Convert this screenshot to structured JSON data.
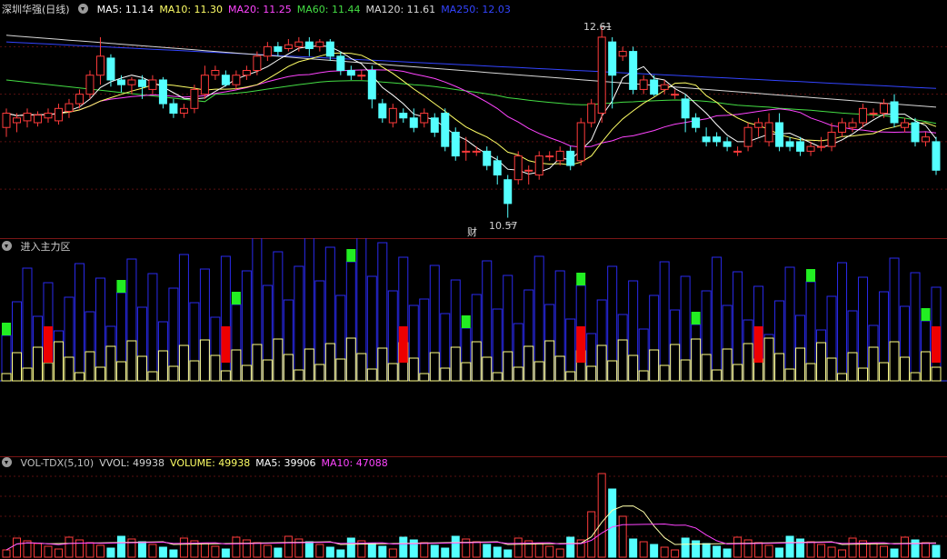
{
  "main_panel": {
    "title": "深圳华强(日线)",
    "ma": [
      {
        "label": "MA5: 11.14",
        "color": "#ffffff"
      },
      {
        "label": "MA10: 11.30",
        "color": "#ffff66"
      },
      {
        "label": "MA20: 11.25",
        "color": "#ff44ff"
      },
      {
        "label": "MA60: 11.44",
        "color": "#44dd44"
      },
      {
        "label": "MA120: 11.61",
        "color": "#d8d8d8"
      },
      {
        "label": "MA250: 12.03",
        "color": "#3344ff"
      }
    ],
    "high_label": "12.61",
    "low_label": "10.57",
    "marker_text": "财"
  },
  "indicator_panel": {
    "title": "进入主力区"
  },
  "volume_panel": {
    "items": [
      {
        "label": "VOL-TDX(5,10)",
        "color": "#c0c0c0"
      },
      {
        "label": "VVOL: 49938",
        "color": "#d0d0d0"
      },
      {
        "label": "VOLUME: 49938",
        "color": "#ffff66"
      },
      {
        "label": "MA5: 39906",
        "color": "#ffffff"
      },
      {
        "label": "MA10: 47088",
        "color": "#ff44ff"
      }
    ]
  },
  "chart_data": {
    "type": "candlestick",
    "candles": [
      [
        11.55,
        11.7,
        11.75,
        11.45
      ],
      [
        11.6,
        11.65,
        11.7,
        11.5
      ],
      [
        11.62,
        11.7,
        11.75,
        11.55
      ],
      [
        11.6,
        11.68,
        11.72,
        11.56
      ],
      [
        11.65,
        11.7,
        11.75,
        11.6
      ],
      [
        11.62,
        11.75,
        11.8,
        11.58
      ],
      [
        11.72,
        11.8,
        11.85,
        11.65
      ],
      [
        11.8,
        11.9,
        11.95,
        11.75
      ],
      [
        11.9,
        12.1,
        12.15,
        11.85
      ],
      [
        12.1,
        12.3,
        12.5,
        12.0
      ],
      [
        12.28,
        12.05,
        12.32,
        11.98
      ],
      [
        12.05,
        12.0,
        12.1,
        11.92
      ],
      [
        12.0,
        12.05,
        12.08,
        11.9
      ],
      [
        12.05,
        11.98,
        12.1,
        11.85
      ],
      [
        11.95,
        12.05,
        12.1,
        11.9
      ],
      [
        12.05,
        11.8,
        12.08,
        11.75
      ],
      [
        11.8,
        11.7,
        11.85,
        11.65
      ],
      [
        11.7,
        11.75,
        11.8,
        11.65
      ],
      [
        11.75,
        11.95,
        12.0,
        11.7
      ],
      [
        11.9,
        12.1,
        12.2,
        11.85
      ],
      [
        12.1,
        12.15,
        12.2,
        12.05
      ],
      [
        12.1,
        12.0,
        12.15,
        11.98
      ],
      [
        12.0,
        12.1,
        12.15,
        11.95
      ],
      [
        12.1,
        12.15,
        12.2,
        12.05
      ],
      [
        12.15,
        12.3,
        12.35,
        12.1
      ],
      [
        12.3,
        12.4,
        12.45,
        12.25
      ],
      [
        12.4,
        12.35,
        12.45,
        12.3
      ],
      [
        12.38,
        12.42,
        12.48,
        12.35
      ],
      [
        12.4,
        12.45,
        12.5,
        12.35
      ],
      [
        12.45,
        12.38,
        12.5,
        12.3
      ],
      [
        12.4,
        12.45,
        12.48,
        12.35
      ],
      [
        12.45,
        12.3,
        12.48,
        12.25
      ],
      [
        12.3,
        12.15,
        12.35,
        12.1
      ],
      [
        12.15,
        12.1,
        12.2,
        12.05
      ],
      [
        12.1,
        12.1,
        12.15,
        12.05
      ],
      [
        12.15,
        11.85,
        12.2,
        11.75
      ],
      [
        11.8,
        11.65,
        11.85,
        11.6
      ],
      [
        11.6,
        11.75,
        11.8,
        11.55
      ],
      [
        11.7,
        11.65,
        11.75,
        11.6
      ],
      [
        11.65,
        11.55,
        11.75,
        11.5
      ],
      [
        11.6,
        11.7,
        11.75,
        11.55
      ],
      [
        11.65,
        11.5,
        11.7,
        11.45
      ],
      [
        11.7,
        11.35,
        11.75,
        11.3
      ],
      [
        11.5,
        11.25,
        11.55,
        11.2
      ],
      [
        11.3,
        11.3,
        11.45,
        11.2
      ],
      [
        11.3,
        11.3,
        11.35,
        11.25
      ],
      [
        11.3,
        11.15,
        11.35,
        11.1
      ],
      [
        11.2,
        11.05,
        11.25,
        10.95
      ],
      [
        11.0,
        10.75,
        11.05,
        10.6
      ],
      [
        11.0,
        11.25,
        11.3,
        10.95
      ],
      [
        11.1,
        11.1,
        11.15,
        10.95
      ],
      [
        11.05,
        11.25,
        11.3,
        11.0
      ],
      [
        11.25,
        11.25,
        11.3,
        11.2
      ],
      [
        11.2,
        11.3,
        11.35,
        11.15
      ],
      [
        11.3,
        11.15,
        11.35,
        11.1
      ],
      [
        11.2,
        11.6,
        11.65,
        11.15
      ],
      [
        11.6,
        11.8,
        11.85,
        11.55
      ],
      [
        11.7,
        12.5,
        12.61,
        11.6
      ],
      [
        12.45,
        12.1,
        12.5,
        11.75
      ],
      [
        12.3,
        12.35,
        12.4,
        12.25
      ],
      [
        12.35,
        11.95,
        12.4,
        11.9
      ],
      [
        11.95,
        12.05,
        12.1,
        11.9
      ],
      [
        12.05,
        11.9,
        12.1,
        11.88
      ],
      [
        11.95,
        12.0,
        12.05,
        11.9
      ],
      [
        11.9,
        11.9,
        11.95,
        11.85
      ],
      [
        11.85,
        11.65,
        11.9,
        11.5
      ],
      [
        11.65,
        11.55,
        11.7,
        11.5
      ],
      [
        11.45,
        11.4,
        11.55,
        11.35
      ],
      [
        11.45,
        11.4,
        11.5,
        11.35
      ],
      [
        11.4,
        11.35,
        11.45,
        11.3
      ],
      [
        11.3,
        11.3,
        11.35,
        11.25
      ],
      [
        11.35,
        11.55,
        11.6,
        11.3
      ],
      [
        11.55,
        11.6,
        11.65,
        11.45
      ],
      [
        11.4,
        11.6,
        11.7,
        11.35
      ],
      [
        11.6,
        11.35,
        11.7,
        11.3
      ],
      [
        11.4,
        11.35,
        11.45,
        11.3
      ],
      [
        11.4,
        11.3,
        11.45,
        11.25
      ],
      [
        11.3,
        11.35,
        11.4,
        11.25
      ],
      [
        11.35,
        11.35,
        11.45,
        11.3
      ],
      [
        11.35,
        11.5,
        11.6,
        11.3
      ],
      [
        11.5,
        11.6,
        11.65,
        11.45
      ],
      [
        11.55,
        11.6,
        11.65,
        11.5
      ],
      [
        11.6,
        11.75,
        11.8,
        11.55
      ],
      [
        11.7,
        11.7,
        11.75,
        11.65
      ],
      [
        11.7,
        11.8,
        11.85,
        11.65
      ],
      [
        11.82,
        11.6,
        11.9,
        11.55
      ],
      [
        11.55,
        11.6,
        11.65,
        11.5
      ],
      [
        11.6,
        11.4,
        11.65,
        11.35
      ],
      [
        11.4,
        11.45,
        11.5,
        11.35
      ],
      [
        11.4,
        11.1,
        11.45,
        11.05
      ]
    ]
  }
}
